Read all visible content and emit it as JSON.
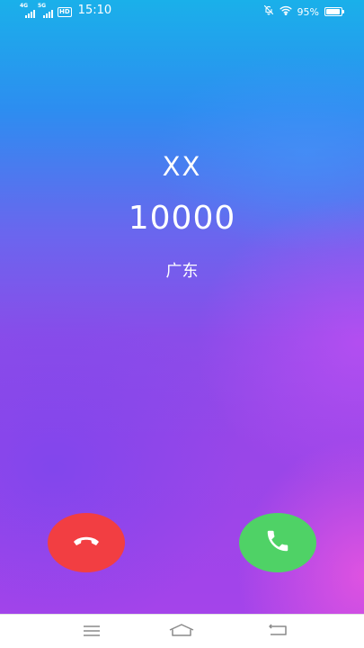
{
  "status_bar": {
    "sim1_label": "4G",
    "sim2_label": "5G",
    "hd_label": "HD",
    "time": "15:10",
    "battery_percent": "95%",
    "battery_level": 0.95
  },
  "call": {
    "name": "XX",
    "number": "10000",
    "location": "广东"
  },
  "icons": {
    "decline": "phone-hangup-icon",
    "answer": "phone-icon",
    "silent": "bell-off-icon",
    "wifi": "wifi-icon"
  },
  "colors": {
    "decline": "#f23e42",
    "answer": "#4fd266"
  }
}
